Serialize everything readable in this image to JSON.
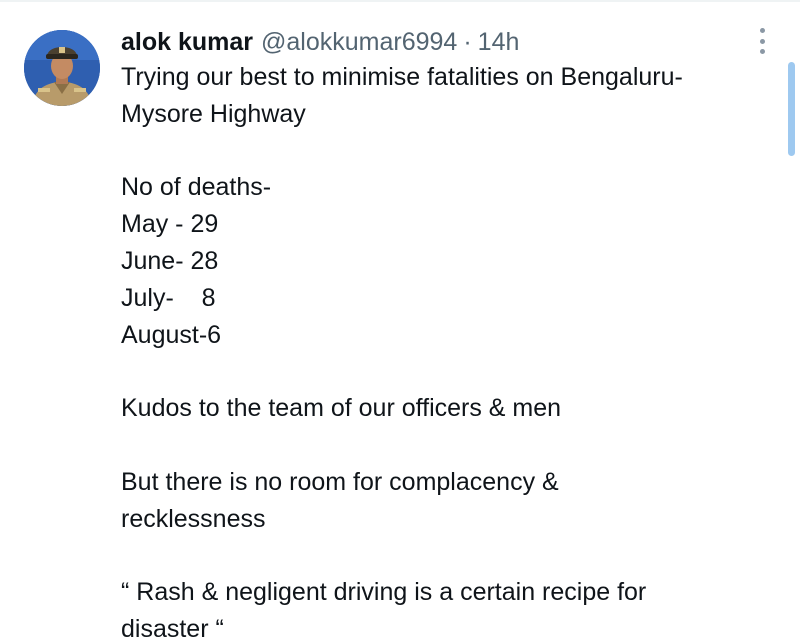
{
  "tweet": {
    "author": {
      "display_name": "alok kumar",
      "handle": "@alokkumar6994",
      "separator": "·",
      "time": "14h"
    },
    "body_lines": [
      "Trying our best to minimise fatalities on Bengaluru-",
      "Mysore Highway",
      "",
      "No of deaths-",
      "May - 29",
      "June- 28",
      "July-    8",
      "August-6",
      "",
      "Kudos to the team of our officers & men",
      "",
      "But there is no room for complacency &",
      "recklessness",
      "",
      "“ Rash & negligent driving is a certain recipe for",
      "disaster “"
    ],
    "icons": {
      "avatar": "police-officer-avatar",
      "more": "more-options-icon"
    }
  },
  "colors": {
    "text_primary": "#0f1419",
    "text_secondary": "#536471",
    "scrollbar": "#9ec9f0",
    "divider": "#eff3f4"
  }
}
